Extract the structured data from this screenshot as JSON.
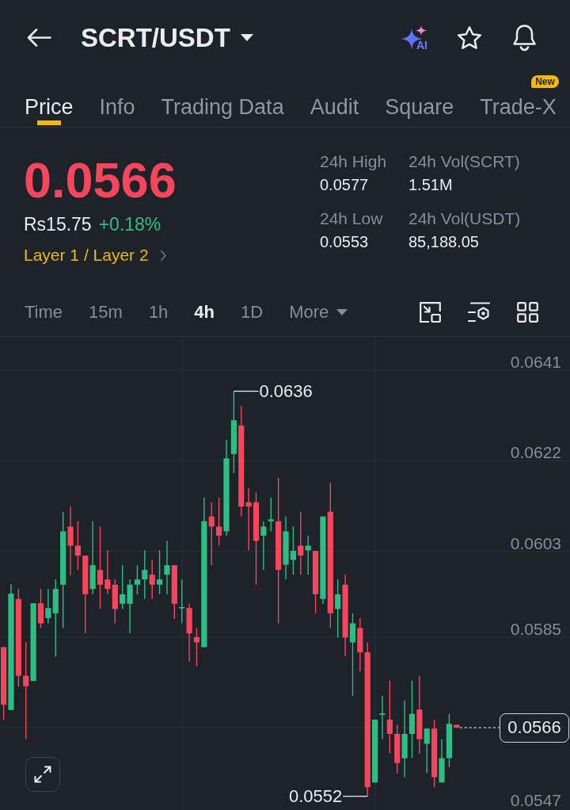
{
  "header": {
    "title": "SCRT/USDT",
    "ai_label": "AI"
  },
  "tabs": [
    {
      "label": "Price",
      "selected": true
    },
    {
      "label": "Info",
      "selected": false
    },
    {
      "label": "Trading Data",
      "selected": false
    },
    {
      "label": "Audit",
      "selected": false
    },
    {
      "label": "Square",
      "selected": false
    },
    {
      "label": "Trade-X",
      "selected": false,
      "badge": "New"
    }
  ],
  "price": {
    "last": "0.0566",
    "rising": false,
    "fiat": "Rs15.75",
    "change": "+0.18%",
    "change_rising": true,
    "category": "Layer 1 / Layer 2"
  },
  "stats": [
    {
      "label": "24h High",
      "value": "0.0577"
    },
    {
      "label": "24h Vol(SCRT)",
      "value": "1.51M"
    },
    {
      "label": "24h Low",
      "value": "0.0553"
    },
    {
      "label": "24h Vol(USDT)",
      "value": "85,188.05"
    }
  ],
  "intervals": [
    {
      "label": "Time",
      "kind": "option",
      "selected": false
    },
    {
      "label": "15m",
      "kind": "option",
      "selected": false
    },
    {
      "label": "1h",
      "kind": "option",
      "selected": false
    },
    {
      "label": "4h",
      "kind": "option",
      "selected": true
    },
    {
      "label": "1D",
      "kind": "option",
      "selected": false
    },
    {
      "label": "More",
      "kind": "menu",
      "selected": false
    }
  ],
  "chart": {
    "chart_data": {
      "type": "candlestick",
      "ohlc": [
        [
          0.05829,
          0.05829,
          0.05676,
          0.05708
        ],
        [
          0.05697,
          0.05961,
          0.05697,
          0.05941
        ],
        [
          0.0593,
          0.05951,
          0.05746,
          0.05769
        ],
        [
          0.05769,
          0.05839,
          0.05636,
          0.05747
        ],
        [
          0.05758,
          0.05921,
          0.05758,
          0.05921
        ],
        [
          0.05921,
          0.05951,
          0.05869,
          0.05879
        ],
        [
          0.0589,
          0.05951,
          0.05879,
          0.05911
        ],
        [
          0.059,
          0.05971,
          0.05809,
          0.05951
        ],
        [
          0.0596,
          0.06113,
          0.05869,
          0.06072
        ],
        [
          0.06082,
          0.06124,
          0.0598,
          0.06042
        ],
        [
          0.06042,
          0.06093,
          0.05991,
          0.06021
        ],
        [
          0.06021,
          0.06021,
          0.05858,
          0.0594
        ],
        [
          0.05951,
          0.06093,
          0.0594,
          0.06001
        ],
        [
          0.05991,
          0.06082,
          0.05909,
          0.0596
        ],
        [
          0.05971,
          0.06032,
          0.0594,
          0.05951
        ],
        [
          0.0596,
          0.05971,
          0.05879,
          0.05909
        ],
        [
          0.0592,
          0.06001,
          0.05909,
          0.0594
        ],
        [
          0.0592,
          0.05971,
          0.05858,
          0.0596
        ],
        [
          0.0596,
          0.06001,
          0.0594,
          0.05971
        ],
        [
          0.05971,
          0.06032,
          0.0593,
          0.05991
        ],
        [
          0.05981,
          0.06012,
          0.0593,
          0.0596
        ],
        [
          0.0596,
          0.06032,
          0.0594,
          0.05971
        ],
        [
          0.05981,
          0.06052,
          0.0594,
          0.06001
        ],
        [
          0.06001,
          0.06001,
          0.05888,
          0.0592
        ],
        [
          0.05911,
          0.05971,
          0.05879,
          0.05913
        ],
        [
          0.05911,
          0.0592,
          0.05799,
          0.05858
        ],
        [
          0.0585,
          0.05869,
          0.05789,
          0.05839
        ],
        [
          0.05829,
          0.06143,
          0.05829,
          0.06093
        ],
        [
          0.06103,
          0.06133,
          0.06001,
          0.06082
        ],
        [
          0.06082,
          0.06143,
          0.06042,
          0.06063
        ],
        [
          0.06072,
          0.06264,
          0.06063,
          0.06225
        ],
        [
          0.06234,
          0.06366,
          0.06194,
          0.06305
        ],
        [
          0.06294,
          0.06335,
          0.06103,
          0.06124
        ],
        [
          0.06133,
          0.06163,
          0.06032,
          0.06124
        ],
        [
          0.06133,
          0.06154,
          0.0596,
          0.06052
        ],
        [
          0.06063,
          0.06093,
          0.05991,
          0.06082
        ],
        [
          0.06093,
          0.06143,
          0.06072,
          0.06097
        ],
        [
          0.06093,
          0.06184,
          0.05879,
          0.05991
        ],
        [
          0.06002,
          0.06103,
          0.05971,
          0.06072
        ],
        [
          0.06012,
          0.06082,
          0.05981,
          0.06031
        ],
        [
          0.06042,
          0.06113,
          0.05981,
          0.06021
        ],
        [
          0.06032,
          0.06063,
          0.05981,
          0.06042
        ],
        [
          0.06031,
          0.06031,
          0.059,
          0.0594
        ],
        [
          0.0593,
          0.06103,
          0.0592,
          0.06103
        ],
        [
          0.06113,
          0.06174,
          0.05869,
          0.059
        ],
        [
          0.05909,
          0.05971,
          0.05849,
          0.0594
        ],
        [
          0.0596,
          0.05981,
          0.0581,
          0.05849
        ],
        [
          0.05839,
          0.059,
          0.05727,
          0.05879
        ],
        [
          0.05869,
          0.0589,
          0.05778,
          0.05818
        ],
        [
          0.05818,
          0.05839,
          0.05516,
          0.05535
        ],
        [
          0.05545,
          0.05677,
          0.05545,
          0.05677
        ],
        [
          0.05687,
          0.05727,
          0.05636,
          0.0569
        ],
        [
          0.05677,
          0.05759,
          0.05606,
          0.05647
        ],
        [
          0.05647,
          0.05666,
          0.05564,
          0.05586
        ],
        [
          0.05596,
          0.05717,
          0.05556,
          0.05647
        ],
        [
          0.05647,
          0.05759,
          0.05596,
          0.05689
        ],
        [
          0.05698,
          0.05769,
          0.05606,
          0.05636
        ],
        [
          0.05626,
          0.05658,
          0.05565,
          0.05658
        ],
        [
          0.05658,
          0.05677,
          0.05535,
          0.05556
        ],
        [
          0.05545,
          0.05636,
          0.05545,
          0.05596
        ],
        [
          0.05596,
          0.05689,
          0.05577,
          0.05668
        ],
        [
          0.05666,
          0.05666,
          0.0566,
          0.0566
        ]
      ],
      "ylim": [
        0.0547,
        0.0641
      ],
      "yticks": [
        0.0641,
        0.0622,
        0.0603,
        0.0585,
        0.0547
      ],
      "grid": true,
      "annotations": [
        "0.0636",
        "0.0552",
        "0.0566"
      ]
    }
  }
}
